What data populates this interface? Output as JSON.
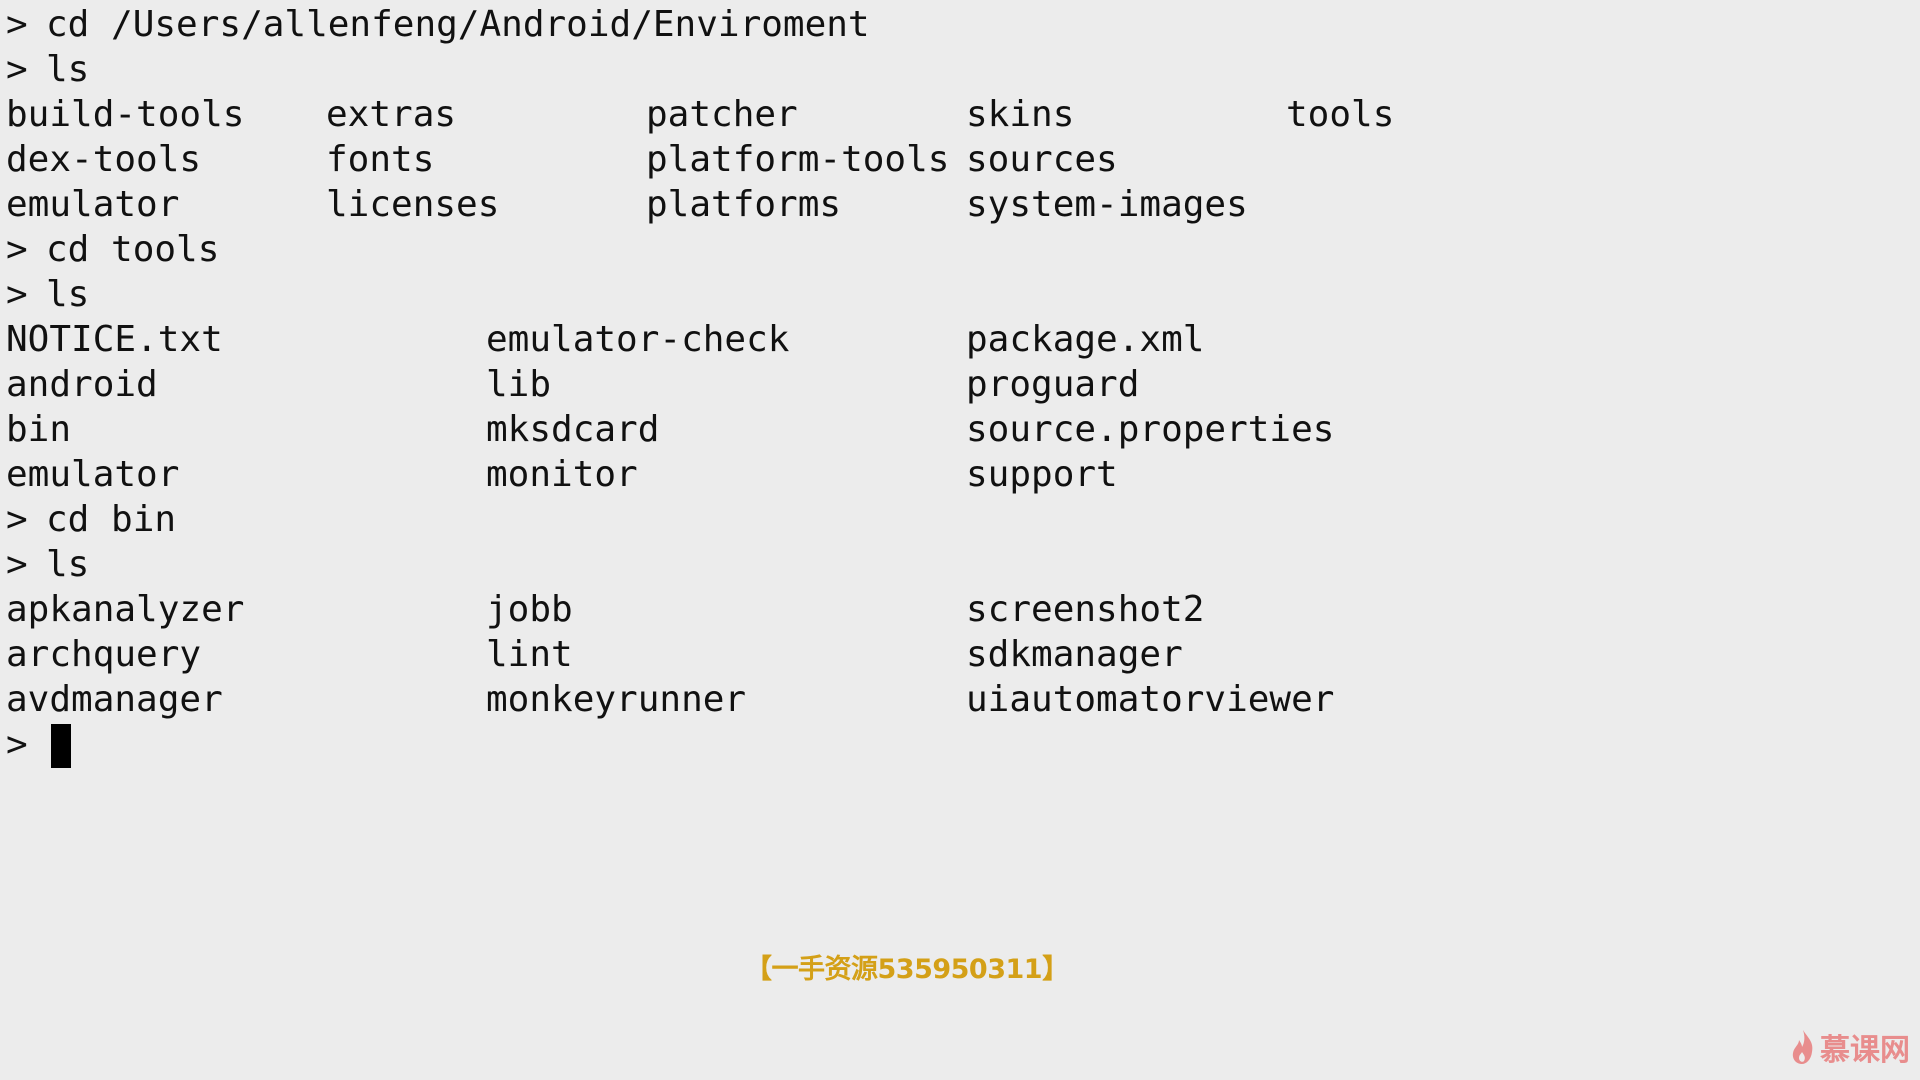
{
  "terminal": {
    "prompt": ">",
    "commands": [
      "cd /Users/allenfeng/Android/Enviroment",
      "ls",
      "cd tools",
      "ls",
      "cd bin",
      "ls"
    ],
    "listing_enviroment": [
      [
        "build-tools",
        "extras",
        "patcher",
        "skins",
        "tools"
      ],
      [
        "dex-tools",
        "fonts",
        "platform-tools",
        "sources"
      ],
      [
        "emulator",
        "licenses",
        "platforms",
        "system-images"
      ]
    ],
    "listing_tools": [
      [
        "NOTICE.txt",
        "emulator-check",
        "package.xml"
      ],
      [
        "android",
        "lib",
        "proguard"
      ],
      [
        "bin",
        "mksdcard",
        "source.properties"
      ],
      [
        "emulator",
        "monitor",
        "support"
      ]
    ],
    "listing_bin": [
      [
        "apkanalyzer",
        "jobb",
        "screenshot2"
      ],
      [
        "archquery",
        "lint",
        "sdkmanager"
      ],
      [
        "avdmanager",
        "monkeyrunner",
        "uiautomatorviewer"
      ]
    ]
  },
  "watermark": "【一手资源535950311】",
  "logo": {
    "text": "慕课网",
    "icon": "flame-icon",
    "color": "#e87d7d"
  },
  "colors": {
    "background": "#ececec",
    "text": "#111111",
    "watermark": "#d4a017"
  }
}
